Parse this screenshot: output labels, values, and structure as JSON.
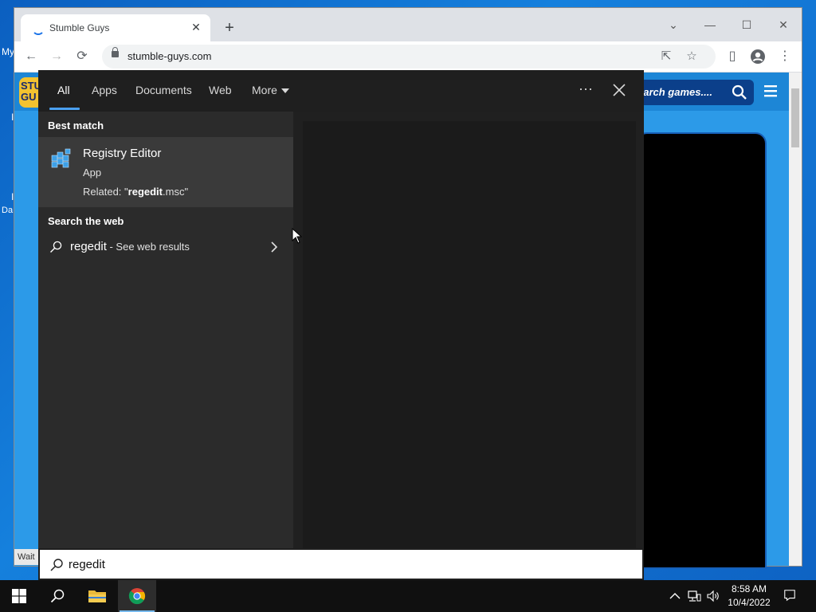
{
  "desktop": {
    "left_fragments": [
      "My",
      "I",
      "I",
      "Da"
    ]
  },
  "browser": {
    "tab_title": "Stumble Guys",
    "tab_close": "✕",
    "new_tab": "+",
    "window_controls": {
      "dropdown": "⌄",
      "minimize": "—",
      "maximize": "☐",
      "close": "✕"
    },
    "url": "stumble-guys.com",
    "nav": {
      "back": "←",
      "forward": "→",
      "reload": "⟳"
    },
    "status_text": "Wait"
  },
  "site": {
    "logo_text": "STU GU",
    "search_placeholder": "earch games....",
    "colors": {
      "header": "#1d86d6",
      "page": "#2c9ae8",
      "logo": "#f2c230"
    }
  },
  "search_panel": {
    "tabs": [
      {
        "label": "All"
      },
      {
        "label": "Apps"
      },
      {
        "label": "Documents"
      },
      {
        "label": "Web"
      },
      {
        "label": "More"
      }
    ],
    "ellipsis": "···",
    "best_match_title": "Best match",
    "best_match": {
      "name": "Registry Editor",
      "type": "App",
      "related_prefix": "Related: \"",
      "related_term": "regedit",
      "related_suffix": ".msc\""
    },
    "search_web_title": "Search the web",
    "web_result": {
      "query": "regedit",
      "suffix": " - See web results"
    },
    "search_box_value": "regedit",
    "accent_color": "#4aa0f0"
  },
  "taskbar": {
    "clock_time": "8:58 AM",
    "clock_date": "10/4/2022",
    "icons": [
      "windows-start-icon",
      "search-icon",
      "file-explorer-icon",
      "chrome-icon"
    ],
    "tray": [
      "chevron-up-icon",
      "network-icon",
      "volume-icon",
      "notification-icon"
    ]
  }
}
